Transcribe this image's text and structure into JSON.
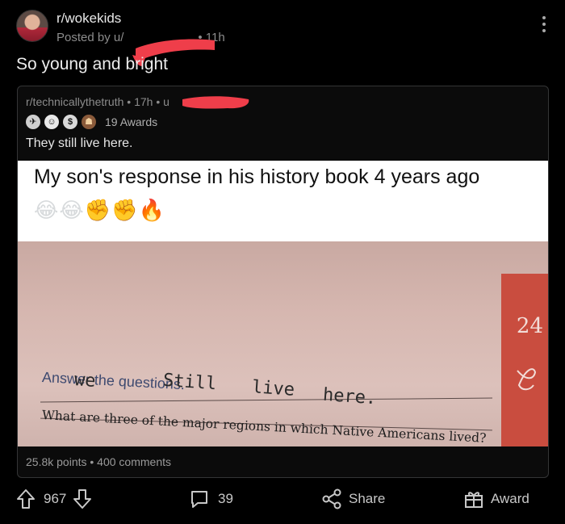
{
  "post": {
    "subreddit": "r/wokekids",
    "posted_by_prefix": "Posted by u/",
    "time": "• 11h",
    "title": "So young and bright"
  },
  "crosspost": {
    "subreddit": "r/technicallythetruth",
    "time": "• 17h •",
    "user_prefix": "u",
    "awards_count": "19 Awards",
    "body": "They still live here.",
    "image": {
      "caption": "My son's response in his history book 4 years ago",
      "emojis": "😂😂✊✊🔥",
      "worksheet": {
        "heading": "Answer the questions.",
        "question": "What are three of the major regions in which Native Americans lived?",
        "answer_words": [
          "we",
          "Still",
          "live",
          "here."
        ],
        "page_number": "24"
      }
    },
    "stats": "25.8k points • 400 comments"
  },
  "actions": {
    "upvotes": "967",
    "comments": "39",
    "share": "Share",
    "award": "Award"
  },
  "colors": {
    "background": "#000000",
    "redaction": "#ef3e4a",
    "card_border": "#343536"
  }
}
